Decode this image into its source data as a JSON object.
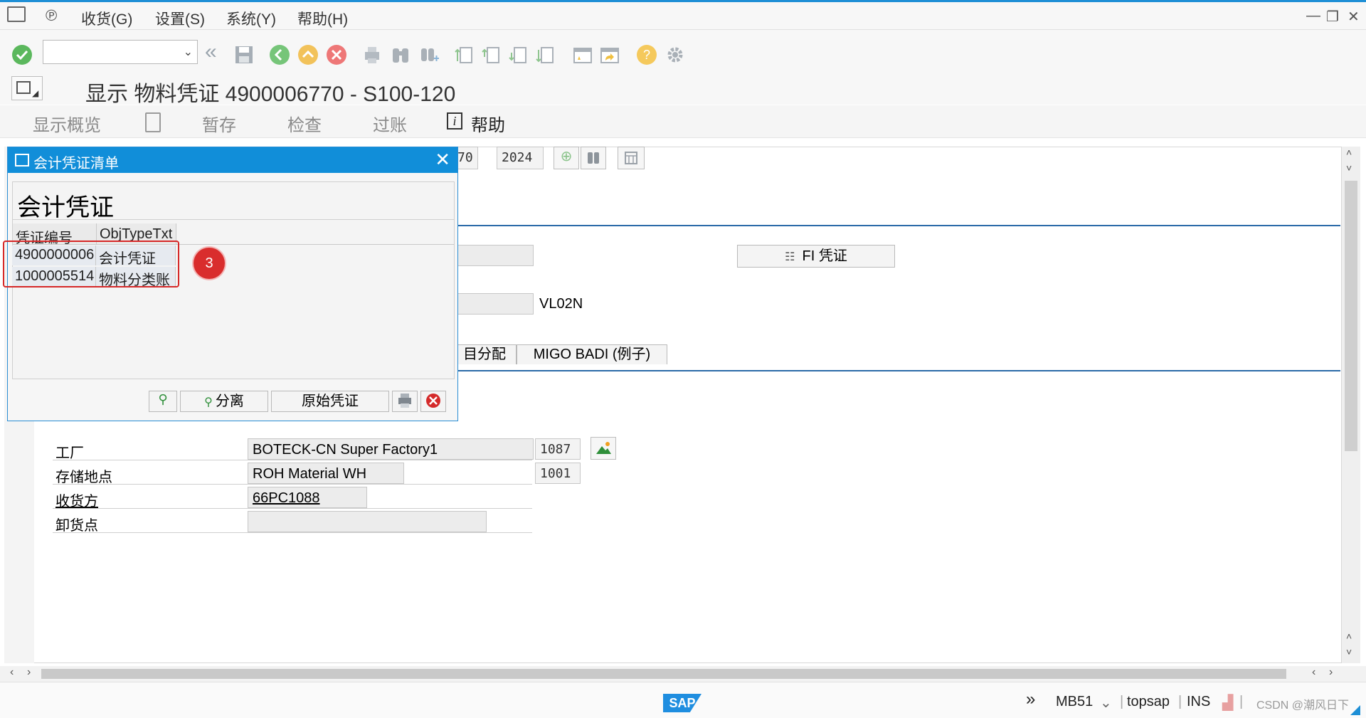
{
  "menu": {
    "items": [
      "收货(G)",
      "设置(S)",
      "系统(Y)",
      "帮助(H)"
    ]
  },
  "toolbar": {
    "command_value": "",
    "icons": [
      "enter-check-icon",
      "dropdown-icon",
      "double-left-icon",
      "save-icon",
      "back-icon",
      "exit-icon",
      "cancel-icon",
      "print-icon",
      "find-icon",
      "find-next-icon",
      "first-page-icon",
      "prev-page-icon",
      "next-page-icon",
      "last-page-icon",
      "new-session-icon",
      "shortcut-icon",
      "help-icon",
      "settings-gear-icon"
    ]
  },
  "title": {
    "text": "显示 物料凭证 4900006770 - S100-120"
  },
  "app_toolbar": {
    "overview": "显示概览",
    "hold": "暂存",
    "check": "检查",
    "post": "过账",
    "help": "帮助"
  },
  "header_fields": {
    "doc_partial": "70",
    "year": "2024"
  },
  "fi_button": "FI 凭证",
  "vl02n": "VL02N",
  "tabs": {
    "partial": "目分配",
    "migo_badi": "MIGO BADI (例子)"
  },
  "form": {
    "plant_label": "工厂",
    "plant_value": "BOTECK-CN Super Factory1",
    "plant_code": "1087",
    "storage_label": "存储地点",
    "storage_value": "ROH Material WH",
    "storage_code": "1001",
    "recipient_label": "收货方",
    "recipient_value": "66PC1088",
    "unloading_label": "卸货点",
    "unloading_value": ""
  },
  "dialog": {
    "title": "会计凭证清单",
    "heading": "会计凭证",
    "columns": [
      "凭证编号",
      "ObjTypeTxt"
    ],
    "rows": [
      {
        "doc": "4900000006",
        "type": "会计凭证"
      },
      {
        "doc": "1000005514",
        "type": "物料分类账"
      }
    ],
    "btn_separate": "分离",
    "btn_original": "原始凭证",
    "annotation_number": "3"
  },
  "status": {
    "tcode": "MB51",
    "server": "topsap",
    "mode": "INS",
    "watermark": "CSDN @潮风日下"
  },
  "colors": {
    "accent_blue": "#118ed9",
    "highlight_red": "#d62828",
    "line_blue": "#2b6aa8"
  }
}
